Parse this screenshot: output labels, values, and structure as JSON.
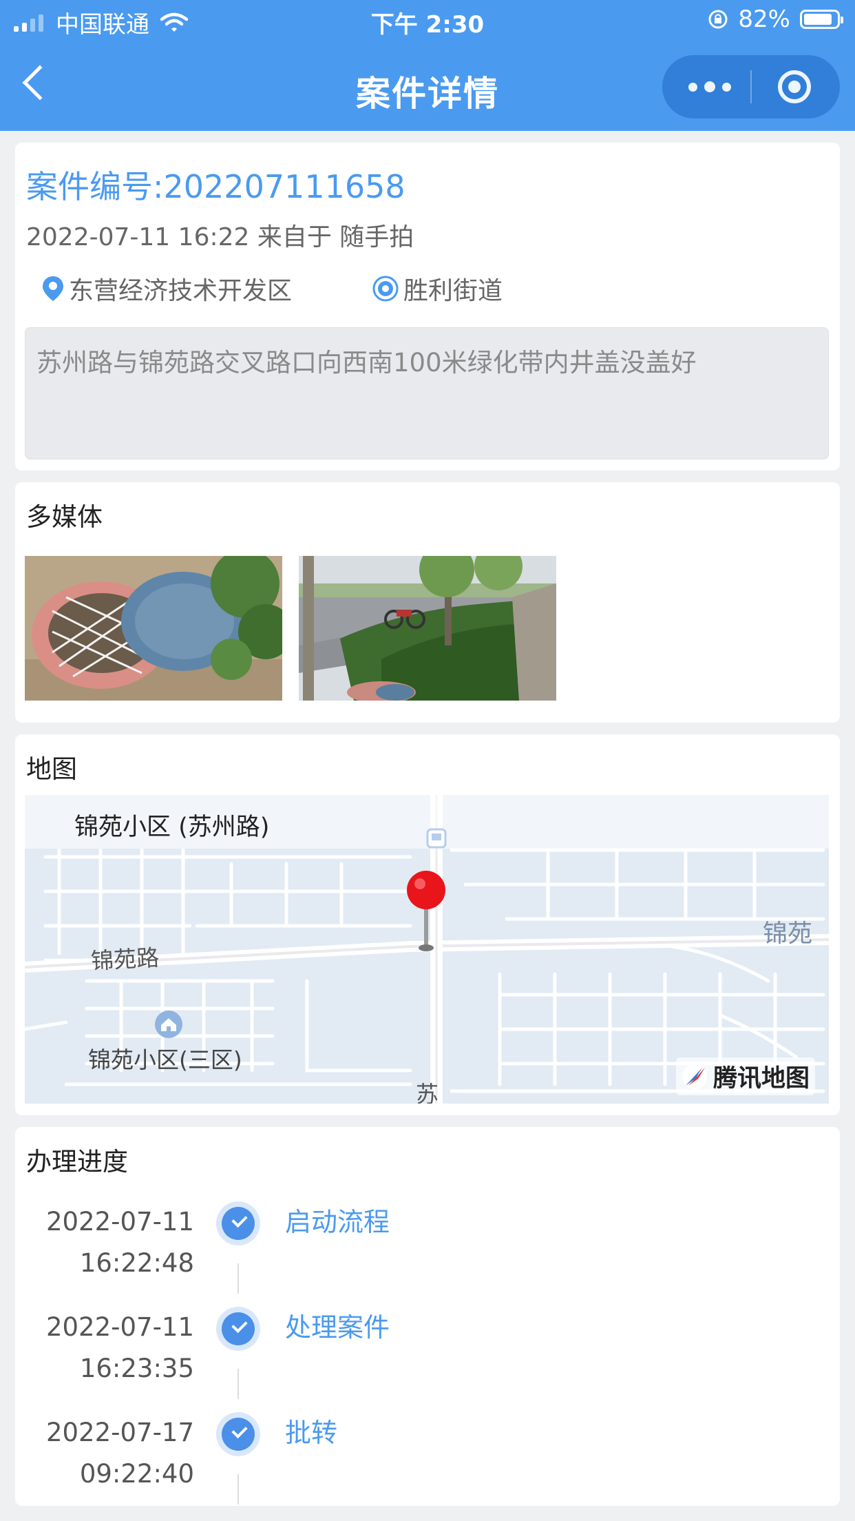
{
  "status_bar": {
    "carrier": "中国联通",
    "time": "下午 2:30",
    "battery": "82%"
  },
  "nav": {
    "title": "案件详情"
  },
  "case": {
    "number": "案件编号:202207111658",
    "meta": "2022-07-11 16:22 来自于 随手拍",
    "district": "东营经济技术开发区",
    "street": "胜利街道",
    "description": "苏州路与锦苑路交叉路口向西南100米绿化带内井盖没盖好"
  },
  "media": {
    "title": "多媒体"
  },
  "map": {
    "title": "地图",
    "place": "锦苑小区 (苏州路)",
    "road": "锦苑路",
    "poi": "锦苑小区(三区)",
    "edge_label": "锦苑",
    "bottom_label": "苏",
    "provider": "腾讯地图"
  },
  "progress": {
    "title": "办理进度",
    "steps": [
      {
        "date": "2022-07-11",
        "time": "16:22:48",
        "label": "启动流程"
      },
      {
        "date": "2022-07-11",
        "time": "16:23:35",
        "label": "处理案件"
      },
      {
        "date": "2022-07-17",
        "time": "09:22:40",
        "label": "批转"
      }
    ]
  },
  "colors": {
    "accent": "#4a9af0",
    "marker": "#e8151b"
  }
}
